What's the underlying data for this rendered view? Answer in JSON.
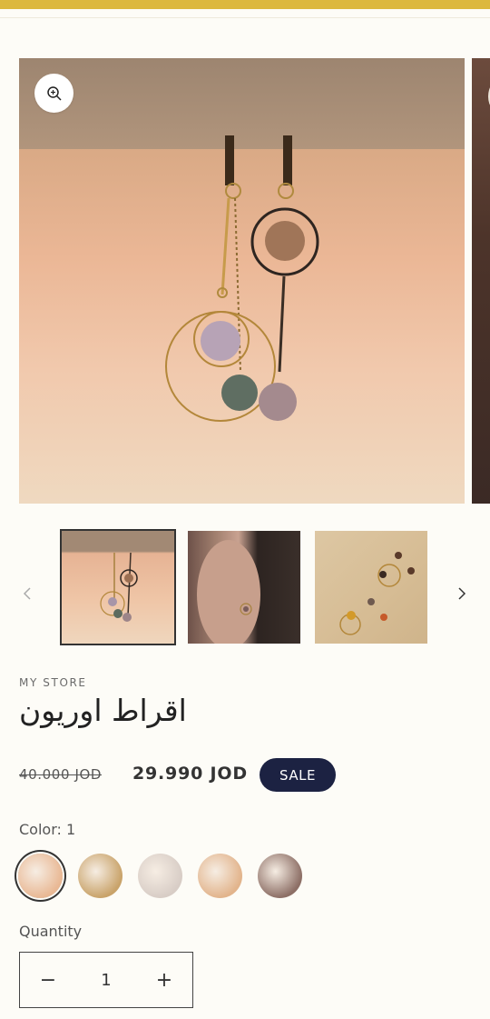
{
  "product": {
    "vendor": "MY STORE",
    "title": "اقراط اوريون",
    "price_old": "40.000 JOD",
    "price_new": "29.990 JOD",
    "sale_badge": "SALE"
  },
  "variant": {
    "color_label": "Color: 1",
    "swatch_colors": [
      "#e9b894",
      "#c9a36a",
      "#d8cdc6",
      "#e2b48c",
      "#8d6f66"
    ]
  },
  "quantity": {
    "label": "Quantity",
    "value": "1",
    "minus": "−",
    "plus": "+"
  },
  "colors": {
    "top_bar": "#dcb83e",
    "sale_badge": "#1c2242"
  }
}
